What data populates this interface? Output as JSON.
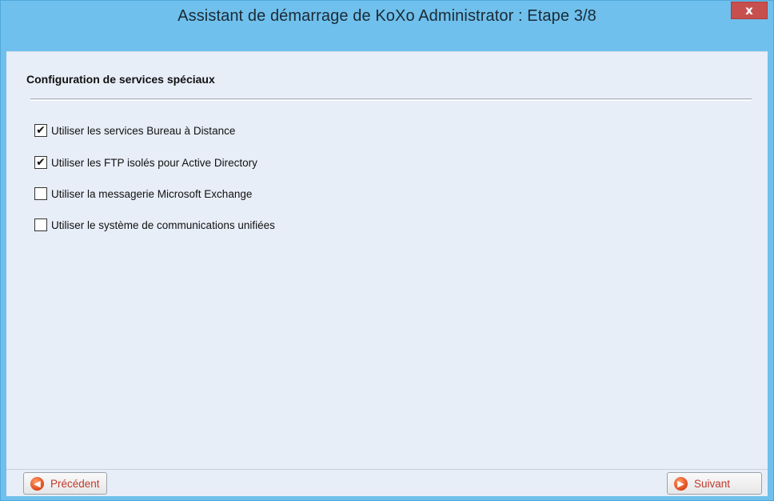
{
  "window": {
    "title": "Assistant de démarrage de KoXo Administrator : Etape 3/8",
    "close_label": "x"
  },
  "section": {
    "title": "Configuration de services spéciaux"
  },
  "options": [
    {
      "label": "Utiliser les services Bureau à Distance",
      "checked": true,
      "mark": "✔"
    },
    {
      "label": "Utiliser les FTP isolés pour Active Directory",
      "checked": true,
      "mark": "✔"
    },
    {
      "label": "Utiliser la messagerie Microsoft Exchange",
      "checked": false,
      "mark": ""
    },
    {
      "label": "Utiliser le système de communications unifiées",
      "checked": false,
      "mark": ""
    }
  ],
  "navigation": {
    "previous_label": "Précédent",
    "next_label": "Suivant",
    "previous_icon": "arrow-left-icon",
    "next_icon": "arrow-right-icon"
  },
  "colors": {
    "titlebar": "#6fc0ec",
    "content_bg": "#e8eef8",
    "close_button": "#c7504f",
    "nav_text": "#c0392b"
  }
}
